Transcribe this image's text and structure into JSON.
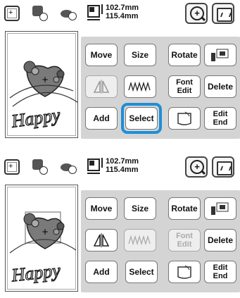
{
  "screens": [
    {
      "size": {
        "height": "102.7mm",
        "width": "115.4mm"
      },
      "buttons": {
        "move": "Move",
        "size": "Size",
        "rotate": "Rotate",
        "font_edit": "Font\nEdit",
        "delete": "Delete",
        "add": "Add",
        "select": "Select",
        "edit_end": "Edit\nEnd"
      },
      "font_edit_disabled": false,
      "mirror_disabled": true,
      "density_disabled": false,
      "select_highlighted": true
    },
    {
      "size": {
        "height": "102.7mm",
        "width": "115.4mm"
      },
      "buttons": {
        "move": "Move",
        "size": "Size",
        "rotate": "Rotate",
        "font_edit": "Font\nEdit",
        "delete": "Delete",
        "add": "Add",
        "select": "Select",
        "edit_end": "Edit\nEnd"
      },
      "font_edit_disabled": true,
      "mirror_disabled": false,
      "density_disabled": true,
      "select_highlighted": false
    }
  ],
  "design_text": "Happy",
  "colors": {
    "highlight": "#1f8ed6",
    "panel": "#d4d4d4"
  }
}
